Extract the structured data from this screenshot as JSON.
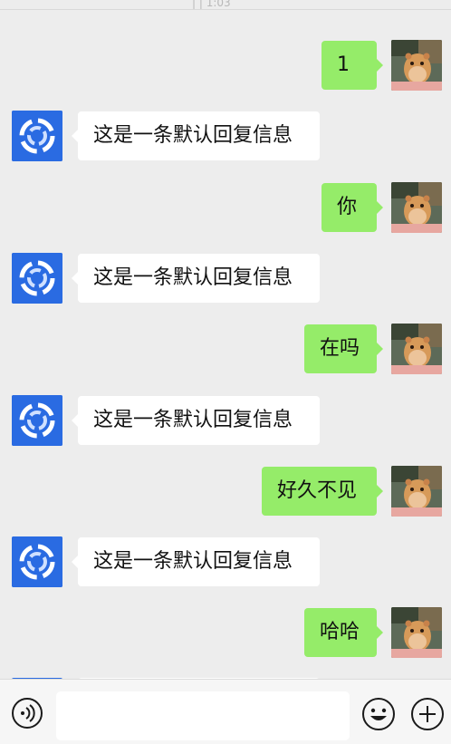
{
  "chat": {
    "timestamp_fragment": "|  |   1:03",
    "messages": [
      {
        "side": "right",
        "text": "1"
      },
      {
        "side": "left",
        "text": "这是一条默认回复信息"
      },
      {
        "side": "right",
        "text": "你"
      },
      {
        "side": "left",
        "text": "这是一条默认回复信息"
      },
      {
        "side": "right",
        "text": "在吗"
      },
      {
        "side": "left",
        "text": "这是一条默认回复信息"
      },
      {
        "side": "right",
        "text": "好久不见"
      },
      {
        "side": "left",
        "text": "这是一条默认回复信息"
      },
      {
        "side": "right",
        "text": "哈哈"
      }
    ]
  },
  "input_bar": {
    "message_input_value": "",
    "voice_icon": "voice-wave-icon",
    "emoji_icon": "smile-emoji-icon",
    "plus_icon": "plus-icon"
  },
  "colors": {
    "background": "#ededed",
    "left_bubble": "#ffffff",
    "right_bubble": "#95ec69",
    "bot_avatar": "#2a6be2",
    "input_bar": "#f6f6f6"
  }
}
